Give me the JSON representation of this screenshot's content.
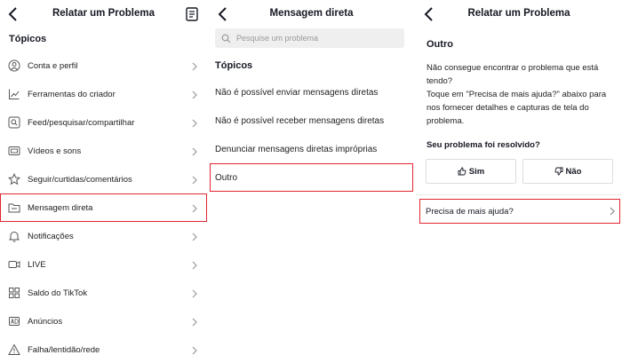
{
  "panel1": {
    "title": "Relatar um Problema",
    "section": "Tópicos",
    "items": [
      {
        "label": "Conta e perfil",
        "icon": "user-icon"
      },
      {
        "label": "Ferramentas do criador",
        "icon": "chart-icon"
      },
      {
        "label": "Feed/pesquisar/compartilhar",
        "icon": "search-box-icon"
      },
      {
        "label": "Vídeos e sons",
        "icon": "video-icon"
      },
      {
        "label": "Seguir/curtidas/comentários",
        "icon": "star-icon"
      },
      {
        "label": "Mensagem direta",
        "icon": "folder-icon"
      },
      {
        "label": "Notificações",
        "icon": "bell-icon"
      },
      {
        "label": "LIVE",
        "icon": "live-icon"
      },
      {
        "label": "Saldo do TikTok",
        "icon": "grid-icon"
      },
      {
        "label": "Anúncios",
        "icon": "ad-icon"
      },
      {
        "label": "Falha/lentidão/rede",
        "icon": "warning-icon"
      }
    ]
  },
  "panel2": {
    "title": "Mensagem direta",
    "search_placeholder": "Pesquise um problema",
    "section": "Tópicos",
    "items": [
      "Não é possível enviar mensagens diretas",
      "Não é possível receber mensagens diretas",
      "Denunciar mensagens diretas impróprias",
      "Outro"
    ]
  },
  "panel3": {
    "title": "Relatar um Problema",
    "heading": "Outro",
    "text_line1": "Não consegue encontrar o problema que está tendo?",
    "text_line2": "Toque em \"Precisa de mais ajuda?\" abaixo para nos fornecer detalhes e capturas de tela do problema.",
    "question": "Seu problema foi resolvido?",
    "yes": "Sim",
    "no": "Não",
    "help": "Precisa de mais ajuda?"
  },
  "colors": {
    "highlight": "#e0262f",
    "text": "#161823"
  }
}
